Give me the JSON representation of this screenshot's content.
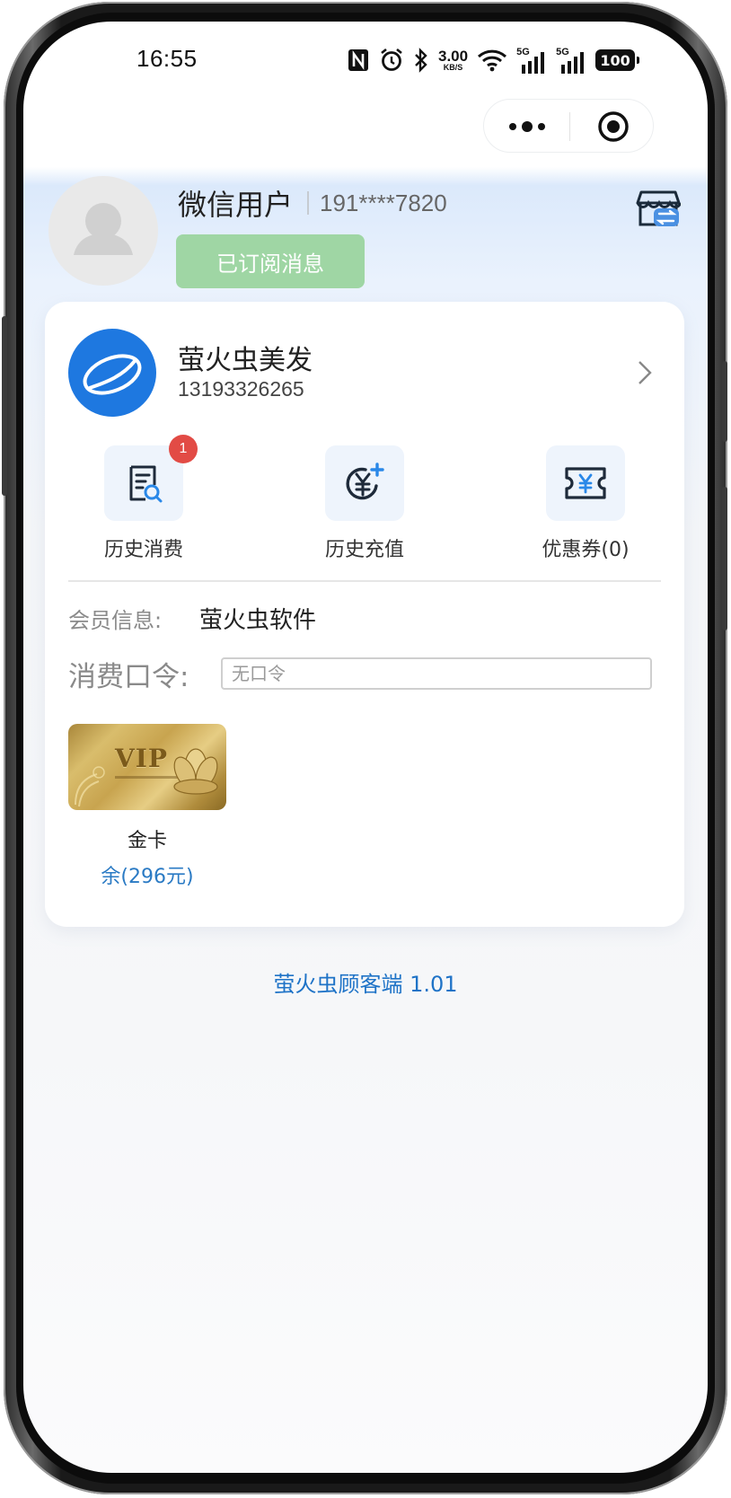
{
  "status_bar": {
    "time": "16:55",
    "net_speed_value": "3.00",
    "net_speed_unit": "KB/S",
    "signal_label": "5G",
    "battery": "100"
  },
  "profile": {
    "username": "微信用户",
    "phone_masked": "191****7820",
    "subscribe_label": "已订阅消息"
  },
  "shop": {
    "name": "萤火虫美发",
    "phone": "13193326265"
  },
  "actions": [
    {
      "label": "历史消费",
      "badge": "1",
      "icon": "receipt-search-icon"
    },
    {
      "label": "历史充值",
      "icon": "yuan-recharge-icon"
    },
    {
      "label": "优惠券(0)",
      "icon": "coupon-icon"
    }
  ],
  "member": {
    "info_label": "会员信息:",
    "info_value": "萤火虫软件",
    "code_label": "消费口令:",
    "code_placeholder": "无口令"
  },
  "vip_card": {
    "card_text": "VIP",
    "name": "金卡",
    "balance": "余(296元)"
  },
  "footer": {
    "version": "萤火虫顾客端 1.01"
  },
  "colors": {
    "accent_blue": "#1e78e0",
    "subscribe_green": "#9fd6a4",
    "badge_red": "#e24b45",
    "link_blue": "#2a7ac4"
  }
}
